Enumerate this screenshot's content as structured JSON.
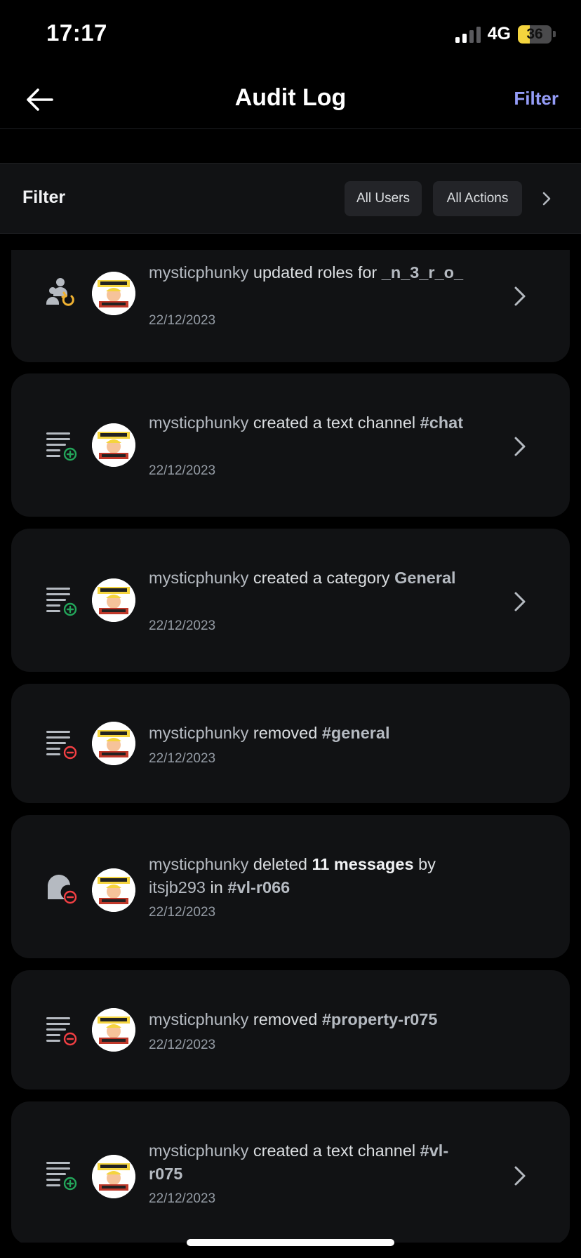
{
  "status_bar": {
    "time": "17:17",
    "network": "4G",
    "battery_level": "36"
  },
  "header": {
    "title": "Audit Log",
    "filter_label": "Filter"
  },
  "filter_bar": {
    "label": "Filter",
    "users_chip": "All Users",
    "actions_chip": "All Actions"
  },
  "entries": [
    {
      "icon": "member-role-update-icon",
      "user": "mysticphunky",
      "action": " updated roles for ",
      "target": "_n_3_r_o_",
      "date": "22/12/2023",
      "has_chevron": true
    },
    {
      "icon": "channel-create-icon",
      "user": "mysticphunky",
      "action": " created a text channel ",
      "target": "#chat",
      "date": "22/12/2023",
      "has_chevron": true
    },
    {
      "icon": "channel-create-icon",
      "user": "mysticphunky",
      "action": " created a category ",
      "target": "General",
      "date": "22/12/2023",
      "has_chevron": true
    },
    {
      "icon": "channel-delete-icon",
      "user": "mysticphunky",
      "action": " removed ",
      "target": "#general",
      "date": "22/12/2023",
      "has_chevron": false
    },
    {
      "icon": "message-delete-icon",
      "user": "mysticphunky",
      "action": " deleted ",
      "count": "11 messages",
      "by": " by ",
      "author": "itsjb293",
      "in": " in ",
      "target": "#vl-r066",
      "date": "22/12/2023",
      "has_chevron": false
    },
    {
      "icon": "channel-delete-icon",
      "user": "mysticphunky",
      "action": " removed ",
      "target": "#property-r075",
      "date": "22/12/2023",
      "has_chevron": false
    },
    {
      "icon": "channel-create-icon",
      "user": "mysticphunky",
      "action": " created a text channel ",
      "target": "#vl-r075",
      "date": "22/12/2023",
      "has_chevron": true
    }
  ],
  "colors": {
    "background": "#000000",
    "card": "#111214",
    "accent": "#949cf7",
    "create_green": "#23a55a",
    "delete_red": "#f23f43",
    "update_orange": "#f0b232"
  }
}
